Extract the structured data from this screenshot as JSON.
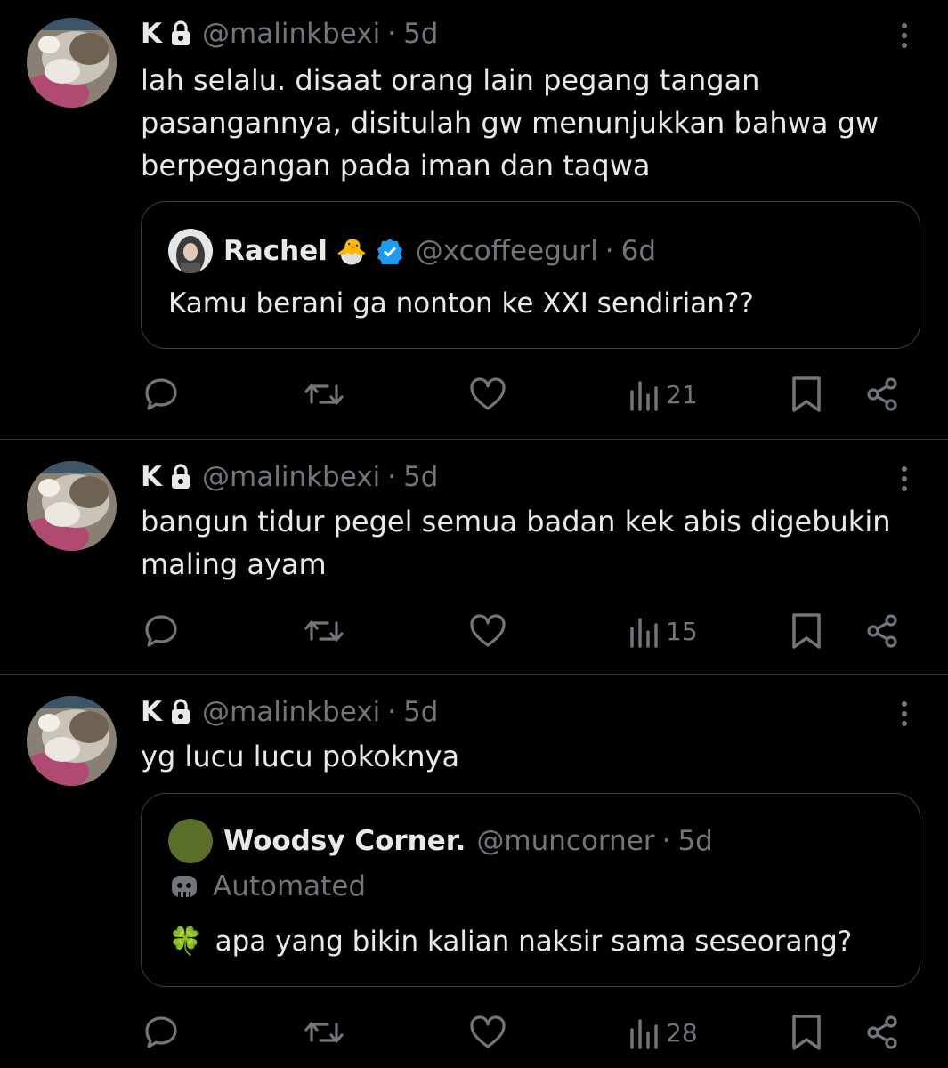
{
  "tweets": [
    {
      "name": "K",
      "handle": "@malinkbexi",
      "separator": "·",
      "time": "5d",
      "text_lines": [
        "lah selalu. disaat orang lain pegang tangan",
        "pasangannya, disitulah gw menunjukkan bahwa gw",
        "berpegangan pada iman dan taqwa"
      ],
      "quote": {
        "name": "Rachel",
        "emoji": "🐣",
        "handle": "@xcoffeegurl",
        "separator": "·",
        "time": "6d",
        "text": "Kamu berani ga nonton ke XXI sendirian??"
      },
      "views": "21"
    },
    {
      "name": "K",
      "handle": "@malinkbexi",
      "separator": "·",
      "time": "5d",
      "text_lines": [
        "bangun tidur pegel semua badan kek abis digebukin",
        "maling ayam"
      ],
      "views": "15"
    },
    {
      "name": "K",
      "handle": "@malinkbexi",
      "separator": "·",
      "time": "5d",
      "text_lines": [
        "yg lucu lucu pokoknya"
      ],
      "quote": {
        "name": "Woodsy Corner.",
        "handle": "@muncorner",
        "separator": "·",
        "time": "5d",
        "automated_label": "Automated",
        "emoji": "🍀",
        "text": "apa yang bikin kalian naksir sama seseorang?"
      },
      "views": "28"
    }
  ],
  "icons": {
    "reply": "reply-icon",
    "retweet": "retweet-icon",
    "like": "like-icon",
    "views": "views-icon",
    "bookmark": "bookmark-icon",
    "share": "share-icon",
    "more": "more-icon",
    "lock": "lock-icon",
    "verified": "verified-badge-icon",
    "bot": "bot-icon"
  },
  "colors": {
    "background": "#000000",
    "text": "#e7e9ea",
    "secondary": "#71767b",
    "divider": "#2f3336",
    "verified": "#1d9bf0"
  }
}
